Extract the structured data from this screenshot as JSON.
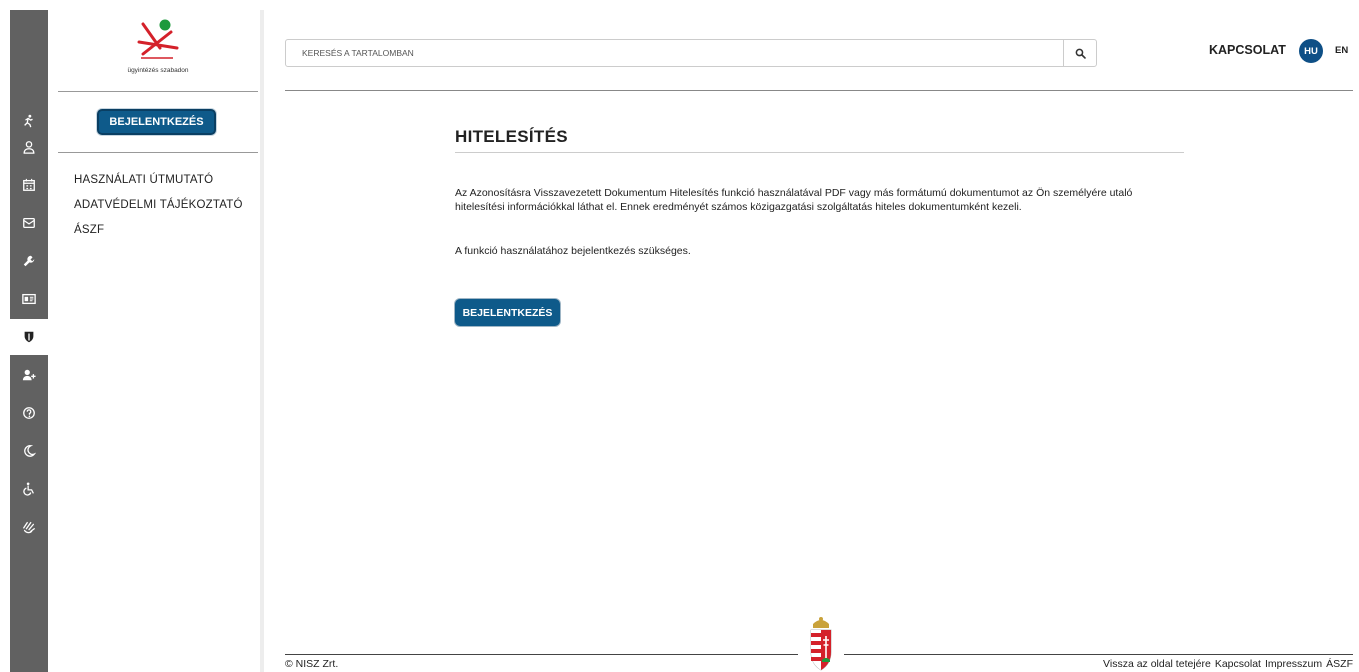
{
  "brand": {
    "tagline": "ügyintézés szabadon"
  },
  "rail": {
    "items": [
      {
        "icon": "person-running-icon"
      },
      {
        "icon": "user-icon"
      },
      {
        "icon": "calendar-icon"
      },
      {
        "icon": "mail-icon"
      },
      {
        "icon": "wrench-icon"
      },
      {
        "icon": "id-card-icon"
      },
      {
        "icon": "shield-icon",
        "active": true
      },
      {
        "icon": "user-plus-icon"
      },
      {
        "icon": "help-icon"
      },
      {
        "icon": "moon-icon"
      },
      {
        "icon": "wheelchair-icon"
      },
      {
        "icon": "sign-language-icon"
      }
    ]
  },
  "sidebar": {
    "login_label": "BEJELENTKEZÉS",
    "links": [
      "HASZNÁLATI ÚTMUTATÓ",
      "ADATVÉDELMI TÁJÉKOZTATÓ",
      "ÁSZF"
    ]
  },
  "header": {
    "search_placeholder": "KERESÉS A TARTALOMBAN",
    "contact_label": "KAPCSOLAT",
    "lang_active": "HU",
    "lang_other": "EN"
  },
  "main": {
    "title": "HITELESÍTÉS",
    "description": "Az Azonosításra Visszavezetett Dokumentum Hitelesítés funkció használatával PDF vagy más formátumú dokumentumot az Ön személyére utaló hitelesítési információkkal láthat el. Ennek eredményét számos közigazgatási szolgáltatás hiteles dokumentumként kezeli.",
    "note": "A funkció használatához bejelentkezés szükséges.",
    "login_label": "BEJELENTKEZÉS"
  },
  "footer": {
    "copyright": "© NISZ Zrt.",
    "links": [
      "Vissza az oldal tetejére",
      "Kapcsolat",
      "Impresszum",
      "ÁSZF"
    ]
  },
  "colors": {
    "primary": "#0e5a8a",
    "rail": "#616161",
    "lang_active": "#0e4f86"
  }
}
